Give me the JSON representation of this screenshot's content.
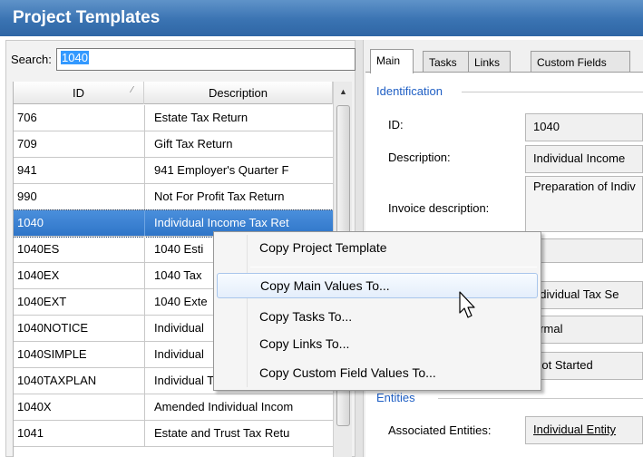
{
  "window": {
    "title": "Project Templates"
  },
  "search": {
    "label": "Search:",
    "value": "1040"
  },
  "grid": {
    "columns": [
      "ID",
      "Description"
    ],
    "sort_icon": "sort-indicator-icon",
    "rows": [
      {
        "id": "706",
        "description": "Estate Tax Return"
      },
      {
        "id": "709",
        "description": "Gift Tax Return"
      },
      {
        "id": "941",
        "description": "941 Employer's Quarter F"
      },
      {
        "id": "990",
        "description": "Not For Profit Tax Return"
      },
      {
        "id": "1040",
        "description": "Individual Income Tax Ret",
        "selected": true
      },
      {
        "id": "1040ES",
        "description": "1040 Esti"
      },
      {
        "id": "1040EX",
        "description": "1040 Tax"
      },
      {
        "id": "1040EXT",
        "description": "1040 Exte"
      },
      {
        "id": "1040NOTICE",
        "description": "Individual"
      },
      {
        "id": "1040SIMPLE",
        "description": "Individual"
      },
      {
        "id": "1040TAXPLAN",
        "description": "Individual Tax Planning"
      },
      {
        "id": "1040X",
        "description": "Amended Individual Incom"
      },
      {
        "id": "1041",
        "description": "Estate and Trust Tax Retu"
      }
    ]
  },
  "tabs": [
    "Main",
    "Tasks",
    "Links",
    "Custom Fields"
  ],
  "main": {
    "identification_title": "Identification",
    "id_label": "ID:",
    "id_value": "1040",
    "description_label": "Description:",
    "description_value": "Individual Income",
    "invoice_label": "Invoice description:",
    "invoice_value": "Preparation of Indiv",
    "field_4_value": "ndividual Tax Se",
    "field_5_value": "ormal",
    "field_6_value": "Not Started",
    "entities_title": "Entities",
    "associated_label": "Associated Entities:",
    "associated_value": "Individual Entity"
  },
  "context_menu": {
    "items": [
      "Copy Project Template",
      "Copy Main Values To...",
      "Copy Tasks To...",
      "Copy Links To...",
      "Copy Custom Field Values To..."
    ],
    "hovered_index": 1
  },
  "colors": {
    "title_bar": "#3a73b2",
    "selection": "#3a80d2",
    "group_title": "#1f5fc4"
  }
}
